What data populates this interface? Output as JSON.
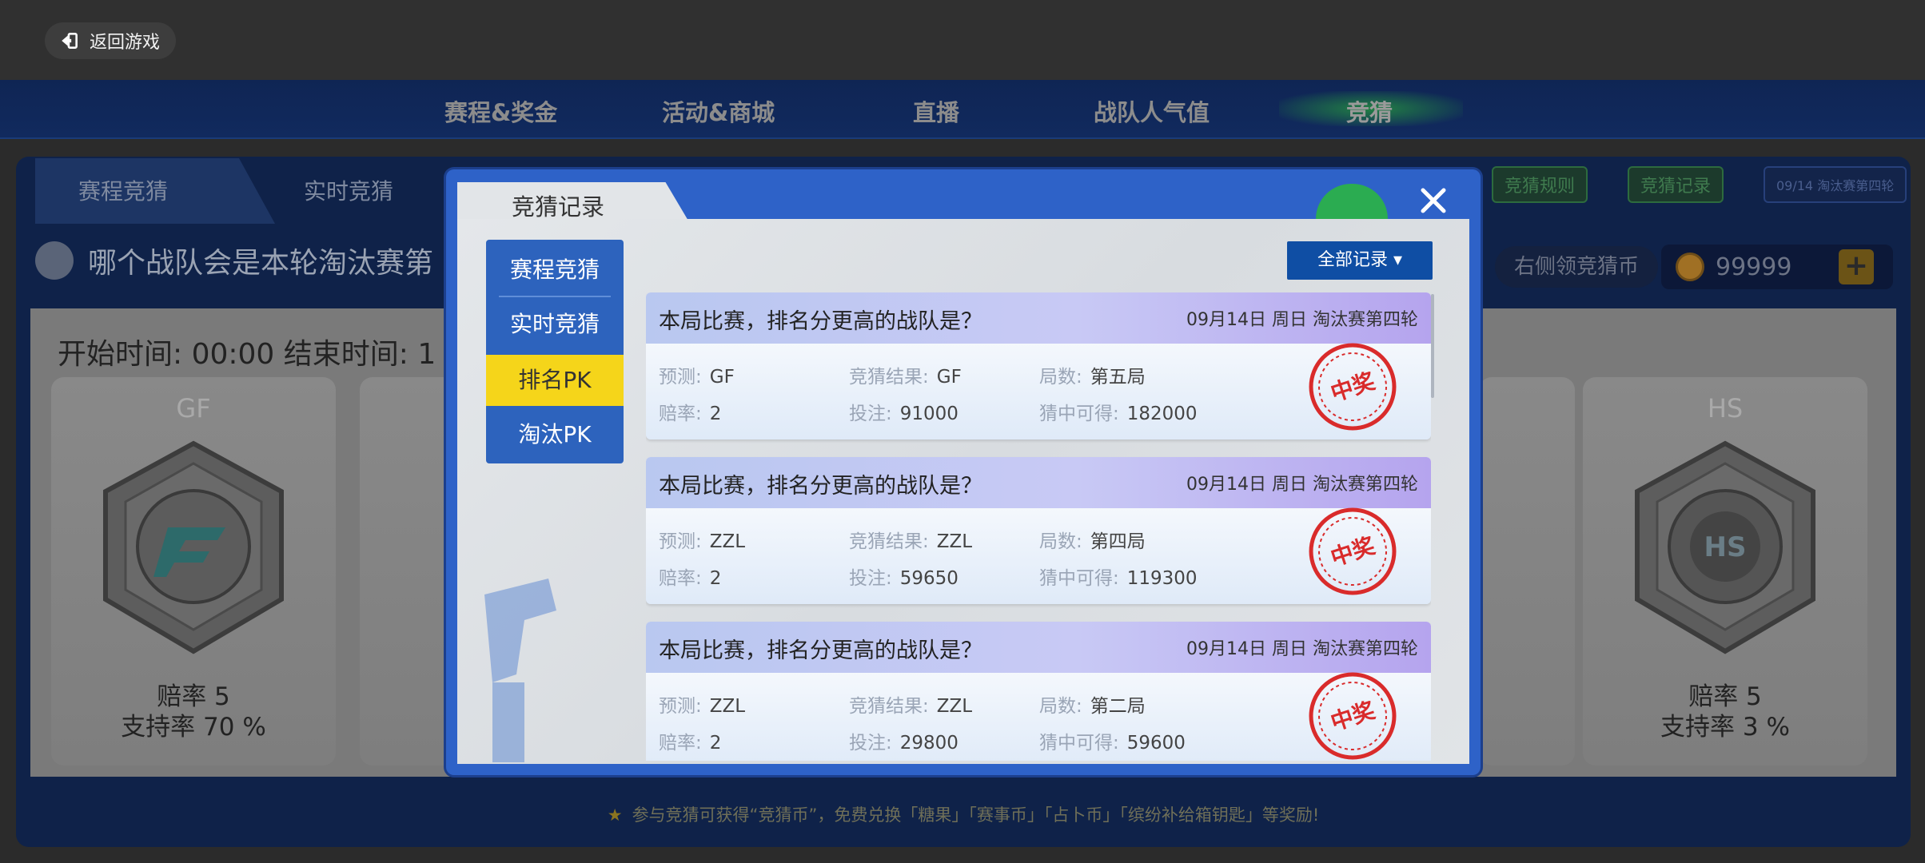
{
  "header": {
    "back_label": "返回游戏"
  },
  "nav": {
    "items": [
      "赛程&奖金",
      "活动&商城",
      "直播",
      "战队人气值",
      "竞猜"
    ],
    "active": "竞猜"
  },
  "subtabs": [
    "赛程竞猜",
    "实时竞猜"
  ],
  "main": {
    "question": "哪个战队会是本轮淘汰赛第",
    "time_line": "开始时间: 00:00 结束时间: 1",
    "hint": "右侧领竞猜币",
    "coins": "99999",
    "right_buttons": [
      "竞猜规则",
      "竞猜记录",
      "09/14 淘汰赛第四轮"
    ],
    "teams": [
      {
        "name": "GF",
        "odds": "赔率 5",
        "support": "支持率 70 %"
      },
      {
        "name": "HS",
        "odds": "赔率 5",
        "support": "支持率 3 %"
      }
    ],
    "partial_support": "支",
    "footer_note": "参与竞猜可获得“竞猜币”，免费兑换「糖果」「赛事币」「占卜币」「缤纷补给箱钥匙」等奖励!"
  },
  "modal": {
    "title": "竞猜记录",
    "filter_label": "全部记录 ▾",
    "side_menu": [
      "赛程竞猜",
      "实时竞猜",
      "排名PK",
      "淘汰PK"
    ],
    "active_side": "排名PK",
    "records": [
      {
        "question": "本局比赛，排名分更高的战队是？",
        "date": "09月14日 周日 淘汰赛第四轮",
        "predict_label": "预测:",
        "predict": "GF",
        "result_label": "竞猜结果:",
        "result": "GF",
        "round_label": "局数:",
        "round": "第五局",
        "odds_label": "赔率:",
        "odds": "2",
        "bet_label": "投注:",
        "bet": "91000",
        "win_label": "猜中可得:",
        "win": "182000",
        "stamp": "中奖"
      },
      {
        "question": "本局比赛，排名分更高的战队是？",
        "date": "09月14日 周日 淘汰赛第四轮",
        "predict_label": "预测:",
        "predict": "ZZL",
        "result_label": "竞猜结果:",
        "result": "ZZL",
        "round_label": "局数:",
        "round": "第四局",
        "odds_label": "赔率:",
        "odds": "2",
        "bet_label": "投注:",
        "bet": "59650",
        "win_label": "猜中可得:",
        "win": "119300",
        "stamp": "中奖"
      },
      {
        "question": "本局比赛，排名分更高的战队是？",
        "date": "09月14日 周日 淘汰赛第四轮",
        "predict_label": "预测:",
        "predict": "ZZL",
        "result_label": "竞猜结果:",
        "result": "ZZL",
        "round_label": "局数:",
        "round": "第二局",
        "odds_label": "赔率:",
        "odds": "2",
        "bet_label": "投注:",
        "bet": "29800",
        "win_label": "猜中可得:",
        "win": "59600",
        "stamp": "中奖"
      }
    ]
  },
  "colors": {
    "modal_blue": "#2e62c8",
    "active_yellow": "#f5d51a",
    "stamp_red": "#d92b2b",
    "nav_bg": "#0f2554"
  }
}
